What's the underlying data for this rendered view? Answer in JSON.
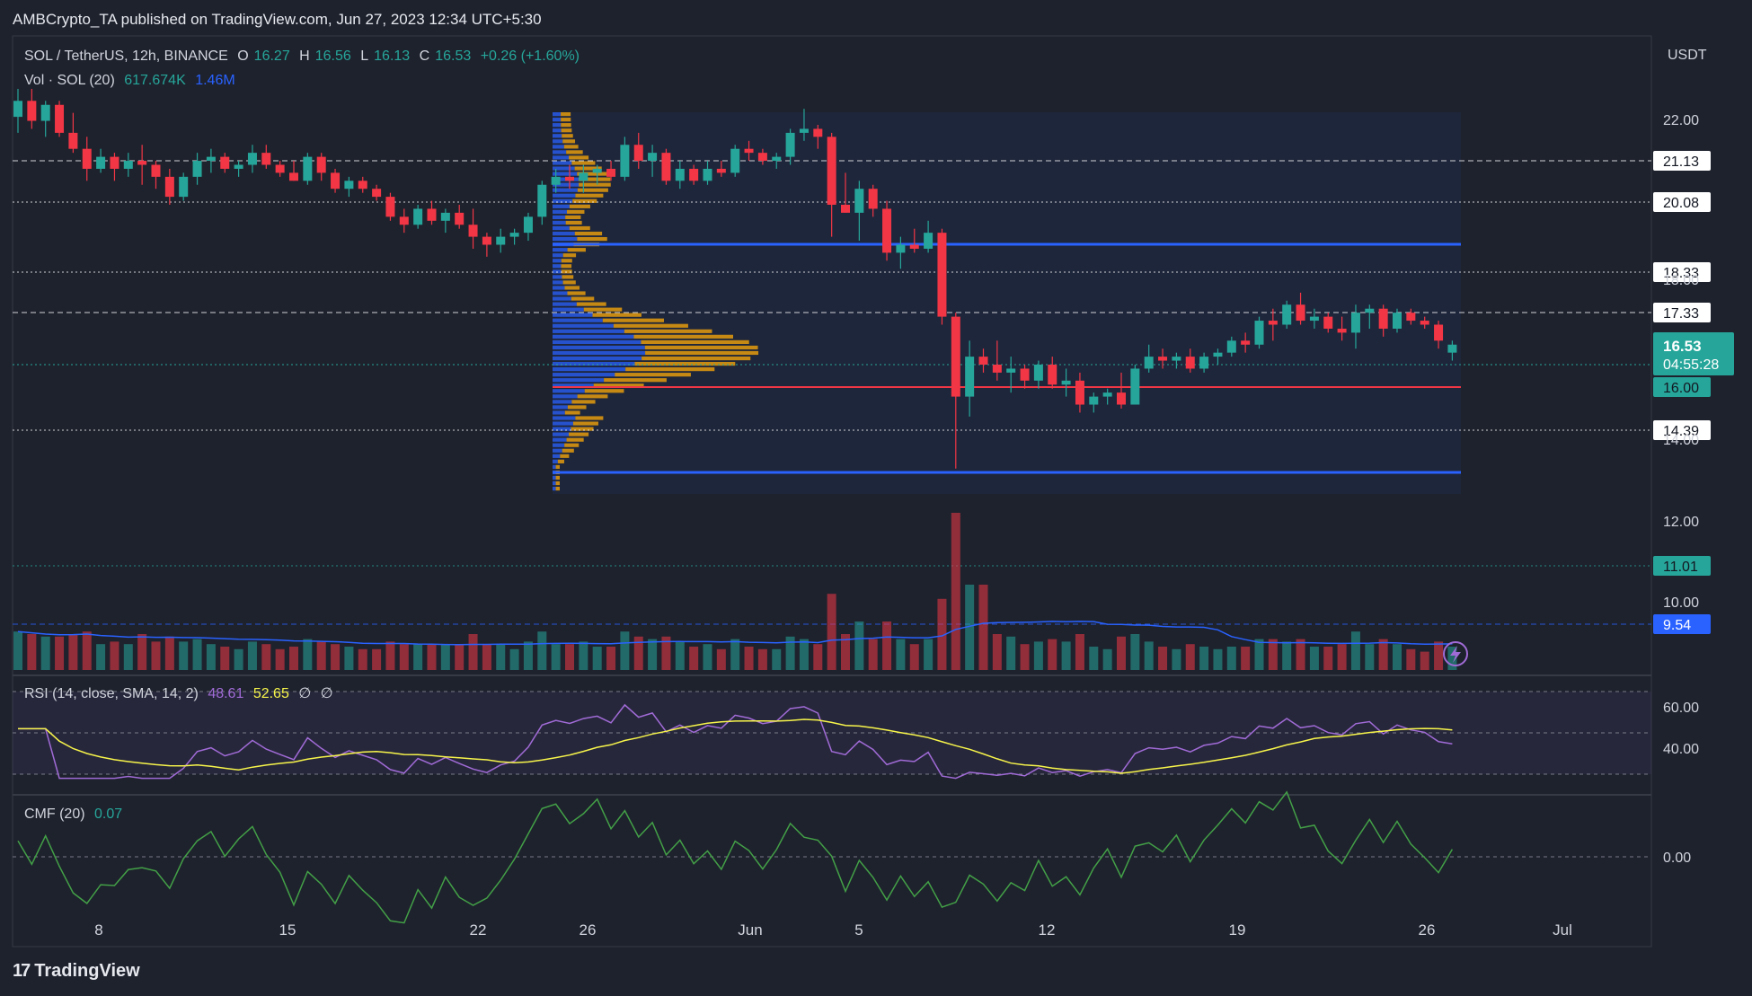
{
  "header": {
    "published": "AMBCrypto_TA published on TradingView.com, Jun 27, 2023 12:34 UTC+5:30"
  },
  "legend": {
    "symbol": "SOL / TetherUS, 12h, BINANCE",
    "o_label": "O",
    "o": "16.27",
    "h_label": "H",
    "h": "16.56",
    "l_label": "L",
    "l": "16.13",
    "c_label": "C",
    "c": "16.53",
    "change": "+0.26 (+1.60%)",
    "vol_label": "Vol · SOL (20)",
    "vol1": "617.674K",
    "vol2": "1.46M",
    "rsi_label": "RSI (14, close, SMA, 14, 2)",
    "rsi1": "48.61",
    "rsi2": "52.65",
    "rsi3": "∅",
    "rsi4": "∅",
    "cmf_label": "CMF (20)",
    "cmf": "0.07"
  },
  "axis": {
    "currency": "USDT",
    "price_ticks": [
      "22.00",
      "18.00",
      "14.00",
      "12.00",
      "10.00"
    ],
    "rsi_ticks": [
      "60.00",
      "40.00"
    ],
    "cmf_ticks": [
      "0.00"
    ],
    "x_ticks": [
      "8",
      "15",
      "22",
      "26",
      "Jun",
      "5",
      "12",
      "19",
      "26",
      "Jul"
    ]
  },
  "levels": [
    {
      "label": "21.13",
      "style": "dashed",
      "color": "#ffffff"
    },
    {
      "label": "20.08",
      "style": "dotted",
      "color": "#ffffff"
    },
    {
      "label": "18.33",
      "style": "dotted",
      "color": "#ffffff"
    },
    {
      "label": "17.33",
      "style": "dashed",
      "color": "#ffffff"
    },
    {
      "label": "16.00",
      "style": "solid",
      "color": "#f23645"
    },
    {
      "label": "14.39",
      "style": "dotted",
      "color": "#ffffff"
    },
    {
      "label": "11.01",
      "style": "dotted",
      "color": "#26a69a"
    },
    {
      "label": "9.54",
      "style": "dashed",
      "color": "#2962ff"
    }
  ],
  "price_badge": {
    "value": "16.53",
    "countdown": "04:55:28"
  },
  "branding": {
    "name": "TradingView"
  },
  "colors": {
    "up": "#26a69a",
    "down": "#f23645",
    "vp_up": "#2962ff",
    "vp_down": "#f0a30a",
    "rsi": "#a06bd6",
    "rsi_ma": "#f7f54a",
    "cmf": "#43a047",
    "vol_ma": "#2962ff"
  },
  "chart_data": {
    "type": "candlestick",
    "interval": "12h",
    "symbol": "SOL/USDT",
    "ylim": [
      9.3,
      22.6
    ],
    "candles_ohlc": [
      [
        22.2,
        22.9,
        21.8,
        22.6
      ],
      [
        22.6,
        22.9,
        21.9,
        22.1
      ],
      [
        22.1,
        22.6,
        21.7,
        22.5
      ],
      [
        22.5,
        22.6,
        21.7,
        21.8
      ],
      [
        21.8,
        22.3,
        21.3,
        21.4
      ],
      [
        21.4,
        21.7,
        20.6,
        20.9
      ],
      [
        20.9,
        21.4,
        20.8,
        21.2
      ],
      [
        21.2,
        21.3,
        20.6,
        20.9
      ],
      [
        20.9,
        21.3,
        20.7,
        21.1
      ],
      [
        21.1,
        21.5,
        20.5,
        21.0
      ],
      [
        21.0,
        21.1,
        20.4,
        20.7
      ],
      [
        20.7,
        20.9,
        20.0,
        20.2
      ],
      [
        20.2,
        20.8,
        20.1,
        20.7
      ],
      [
        20.7,
        21.3,
        20.5,
        21.1
      ],
      [
        21.1,
        21.4,
        20.8,
        21.2
      ],
      [
        21.2,
        21.3,
        20.8,
        20.9
      ],
      [
        20.9,
        21.1,
        20.7,
        21.0
      ],
      [
        21.0,
        21.5,
        20.8,
        21.3
      ],
      [
        21.3,
        21.5,
        20.9,
        21.0
      ],
      [
        21.0,
        21.1,
        20.7,
        20.8
      ],
      [
        20.8,
        21.1,
        20.6,
        20.6
      ],
      [
        20.6,
        21.3,
        20.5,
        21.2
      ],
      [
        21.2,
        21.3,
        20.6,
        20.8
      ],
      [
        20.8,
        20.9,
        20.3,
        20.4
      ],
      [
        20.4,
        20.7,
        20.2,
        20.6
      ],
      [
        20.6,
        20.7,
        20.3,
        20.4
      ],
      [
        20.4,
        20.5,
        20.1,
        20.2
      ],
      [
        20.2,
        20.3,
        19.6,
        19.7
      ],
      [
        19.7,
        19.9,
        19.3,
        19.5
      ],
      [
        19.5,
        20.0,
        19.4,
        19.9
      ],
      [
        19.9,
        20.1,
        19.5,
        19.6
      ],
      [
        19.6,
        19.9,
        19.3,
        19.8
      ],
      [
        19.8,
        20.0,
        19.4,
        19.5
      ],
      [
        19.5,
        19.9,
        18.9,
        19.2
      ],
      [
        19.2,
        19.3,
        18.7,
        19.0
      ],
      [
        19.0,
        19.4,
        18.8,
        19.2
      ],
      [
        19.2,
        19.4,
        19.0,
        19.3
      ],
      [
        19.3,
        19.8,
        19.1,
        19.7
      ],
      [
        19.7,
        20.6,
        19.5,
        20.5
      ],
      [
        20.5,
        20.9,
        20.3,
        20.7
      ],
      [
        20.7,
        21.0,
        20.4,
        20.6
      ],
      [
        20.6,
        21.0,
        20.3,
        20.8
      ],
      [
        20.8,
        21.0,
        20.5,
        20.9
      ],
      [
        20.9,
        21.1,
        20.6,
        20.7
      ],
      [
        20.7,
        21.7,
        20.6,
        21.5
      ],
      [
        21.5,
        21.8,
        20.9,
        21.1
      ],
      [
        21.1,
        21.5,
        20.7,
        21.3
      ],
      [
        21.3,
        21.4,
        20.5,
        20.6
      ],
      [
        20.6,
        21.1,
        20.4,
        20.9
      ],
      [
        20.9,
        21.0,
        20.5,
        20.6
      ],
      [
        20.6,
        21.1,
        20.5,
        20.9
      ],
      [
        20.9,
        21.1,
        20.7,
        20.8
      ],
      [
        20.8,
        21.5,
        20.7,
        21.4
      ],
      [
        21.4,
        21.6,
        21.1,
        21.3
      ],
      [
        21.3,
        21.4,
        21.0,
        21.1
      ],
      [
        21.1,
        21.3,
        20.9,
        21.2
      ],
      [
        21.2,
        21.9,
        21.0,
        21.8
      ],
      [
        21.8,
        22.4,
        21.6,
        21.9
      ],
      [
        21.9,
        22.0,
        21.4,
        21.7
      ],
      [
        21.7,
        21.8,
        19.2,
        20.0
      ],
      [
        20.0,
        20.8,
        19.8,
        19.8
      ],
      [
        19.8,
        20.6,
        19.1,
        20.4
      ],
      [
        20.4,
        20.5,
        19.7,
        19.9
      ],
      [
        19.9,
        20.1,
        18.6,
        18.8
      ],
      [
        18.8,
        19.2,
        18.4,
        19.0
      ],
      [
        19.0,
        19.4,
        18.8,
        18.9
      ],
      [
        18.9,
        19.6,
        18.8,
        19.3
      ],
      [
        19.3,
        19.4,
        17.0,
        17.2
      ],
      [
        17.2,
        17.3,
        13.4,
        15.2
      ],
      [
        15.2,
        16.6,
        14.7,
        16.2
      ],
      [
        16.2,
        16.4,
        15.8,
        16.0
      ],
      [
        16.0,
        16.6,
        15.6,
        15.8
      ],
      [
        15.8,
        16.2,
        15.3,
        15.9
      ],
      [
        15.9,
        16.0,
        15.4,
        15.6
      ],
      [
        15.6,
        16.1,
        15.4,
        16.0
      ],
      [
        16.0,
        16.2,
        15.4,
        15.5
      ],
      [
        15.5,
        15.9,
        15.2,
        15.6
      ],
      [
        15.6,
        15.8,
        14.8,
        15.0
      ],
      [
        15.0,
        15.3,
        14.8,
        15.2
      ],
      [
        15.2,
        15.4,
        15.0,
        15.3
      ],
      [
        15.3,
        15.8,
        14.9,
        15.0
      ],
      [
        15.0,
        16.0,
        15.0,
        15.9
      ],
      [
        15.9,
        16.5,
        15.8,
        16.2
      ],
      [
        16.2,
        16.4,
        15.9,
        16.1
      ],
      [
        16.1,
        16.3,
        15.9,
        16.2
      ],
      [
        16.2,
        16.4,
        15.8,
        15.9
      ],
      [
        15.9,
        16.3,
        15.8,
        16.2
      ],
      [
        16.2,
        16.4,
        16.0,
        16.3
      ],
      [
        16.3,
        16.7,
        16.2,
        16.6
      ],
      [
        16.6,
        16.8,
        16.3,
        16.5
      ],
      [
        16.5,
        17.2,
        16.4,
        17.1
      ],
      [
        17.1,
        17.4,
        16.6,
        17.0
      ],
      [
        17.0,
        17.6,
        16.9,
        17.5
      ],
      [
        17.5,
        17.8,
        17.0,
        17.1
      ],
      [
        17.1,
        17.4,
        16.9,
        17.2
      ],
      [
        17.2,
        17.3,
        16.8,
        16.9
      ],
      [
        16.9,
        17.2,
        16.6,
        16.8
      ],
      [
        16.8,
        17.5,
        16.4,
        17.3
      ],
      [
        17.3,
        17.5,
        16.9,
        17.4
      ],
      [
        17.4,
        17.5,
        16.7,
        16.9
      ],
      [
        16.9,
        17.4,
        16.8,
        17.3
      ],
      [
        17.3,
        17.4,
        17.0,
        17.1
      ],
      [
        17.1,
        17.2,
        16.9,
        17.0
      ],
      [
        17.0,
        17.1,
        16.4,
        16.6
      ],
      [
        16.3,
        16.6,
        16.1,
        16.5
      ]
    ],
    "volume_profile": "visible range, buy/sell split",
    "indicators": {
      "volume": {
        "last": "617.674K",
        "ma": "1.46M"
      },
      "rsi": {
        "value": 48.61,
        "ma": 52.65,
        "ylim": [
          30,
          70
        ]
      },
      "cmf": {
        "value": 0.07
      }
    }
  }
}
